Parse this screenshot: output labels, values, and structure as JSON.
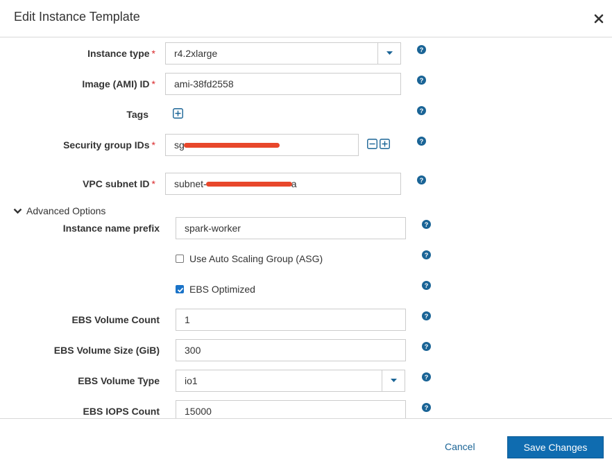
{
  "modal": {
    "title": "Edit Instance Template"
  },
  "fields": {
    "instance_type": {
      "label": "Instance type",
      "value": "r4.2xlarge",
      "required": true
    },
    "image_id": {
      "label": "Image (AMI) ID",
      "value": "ami-38fd2558",
      "required": true
    },
    "tags": {
      "label": "Tags"
    },
    "security_group": {
      "label": "Security group IDs",
      "value": "sg-",
      "required": true
    },
    "vpc_subnet": {
      "label": "VPC subnet ID",
      "value_prefix": "subnet-",
      "value_suffix": "a",
      "required": true
    }
  },
  "advanced": {
    "toggle_label": "Advanced Options",
    "instance_name_prefix": {
      "label": "Instance name prefix",
      "value": "spark-worker"
    },
    "use_asg": {
      "label": "Use Auto Scaling Group (ASG)",
      "checked": false
    },
    "ebs_optimized": {
      "label": "EBS Optimized",
      "checked": true
    },
    "ebs_volume_count": {
      "label": "EBS Volume Count",
      "value": "1"
    },
    "ebs_volume_size": {
      "label": "EBS Volume Size (GiB)",
      "value": "300"
    },
    "ebs_volume_type": {
      "label": "EBS Volume Type",
      "value": "io1"
    },
    "ebs_iops_count": {
      "label": "EBS IOPS Count",
      "value": "15000"
    }
  },
  "footer": {
    "cancel_label": "Cancel",
    "save_label": "Save Changes"
  },
  "colors": {
    "primary": "#0f6cb0",
    "help_icon": "#1a6496",
    "required": "#d9292b",
    "redaction": "#e8472b",
    "link": "#1a6496"
  },
  "icons": {
    "close": "close-icon",
    "help": "help-icon",
    "add": "plus-square-icon",
    "remove": "minus-square-icon",
    "dropdown": "caret-down-icon",
    "toggle": "chevron-down-icon"
  }
}
